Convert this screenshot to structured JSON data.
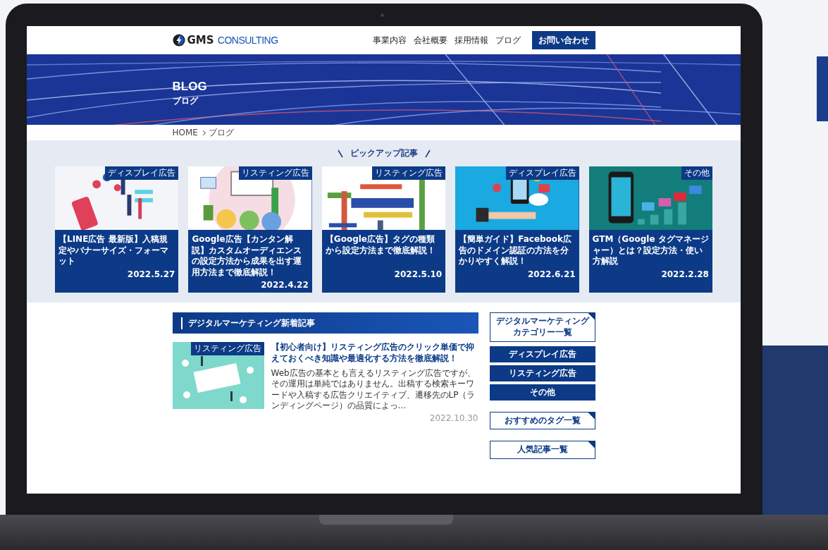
{
  "header": {
    "logo": {
      "primary": "GMS",
      "secondary": "CONSULTING"
    },
    "nav": [
      {
        "label": "事業内容"
      },
      {
        "label": "会社概要"
      },
      {
        "label": "採用情報"
      },
      {
        "label": "ブログ"
      }
    ],
    "contact_button": "お問い合わせ"
  },
  "hero": {
    "title": "BLOG",
    "subtitle": "ブログ"
  },
  "breadcrumb": [
    "HOME",
    "ブログ"
  ],
  "pickup": {
    "heading": "ピックアップ記事",
    "cards": [
      {
        "tag": "ディスプレイ広告",
        "title": "【LINE広告 最新版】入稿規定やバナーサイズ・フォーマット",
        "date": "2022.5.27"
      },
      {
        "tag": "リスティング広告",
        "title": "Google広告【カンタン解説】カスタムオーディエンスの設定方法から成果を出す運用方法まで徹底解説！",
        "date": "2022.4.22"
      },
      {
        "tag": "リスティング広告",
        "title": "【Google広告】タグの種類から設定方法まで徹底解説！",
        "date": "2022.5.10"
      },
      {
        "tag": "ディスプレイ広告",
        "title": "【簡単ガイド】Facebook広告のドメイン認証の方法を分かりやすく解説！",
        "date": "2022.6.21"
      },
      {
        "tag": "その他",
        "title": "GTM（Google タグマネージャー）とは？設定方法・使い方解説",
        "date": "2022.2.28"
      }
    ]
  },
  "latest": {
    "heading": "デジタルマーケティング新着記事",
    "articles": [
      {
        "tag": "リスティング広告",
        "title": "【初心者向け】リスティング広告のクリック単価で抑えておくべき知識や最適化する方法を徹底解説！",
        "excerpt": "Web広告の基本とも言えるリスティング広告ですが、その運用は単純ではありません。出稿する検索キーワードや入稿する広告クリエイティブ、遷移先のLP（ランディングページ）の品質によっ...",
        "date": "2022.10.30"
      }
    ]
  },
  "sidebar": {
    "category_heading": "デジタルマーケティングカテゴリー一覧",
    "categories": [
      "ディスプレイ広告",
      "リスティング広告",
      "その他"
    ],
    "tag_heading": "おすすめのタグ一覧",
    "popular_heading": "人気記事一覧"
  }
}
